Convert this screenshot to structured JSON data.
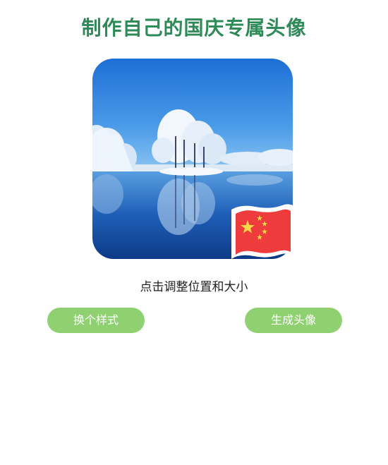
{
  "header": {
    "title": "制作自己的国庆专属头像"
  },
  "avatar": {
    "photo_icon": "winter-lake-photo",
    "badge_icon": "china-flag-icon"
  },
  "hint": {
    "text": "点击调整位置和大小"
  },
  "actions": {
    "change_style_label": "换个样式",
    "generate_label": "生成头像"
  },
  "colors": {
    "title": "#2e8b57",
    "button_bg": "#8fd070",
    "button_text": "#ffffff",
    "flag_red": "#ee3b3b",
    "flag_star": "#ffd84a"
  }
}
